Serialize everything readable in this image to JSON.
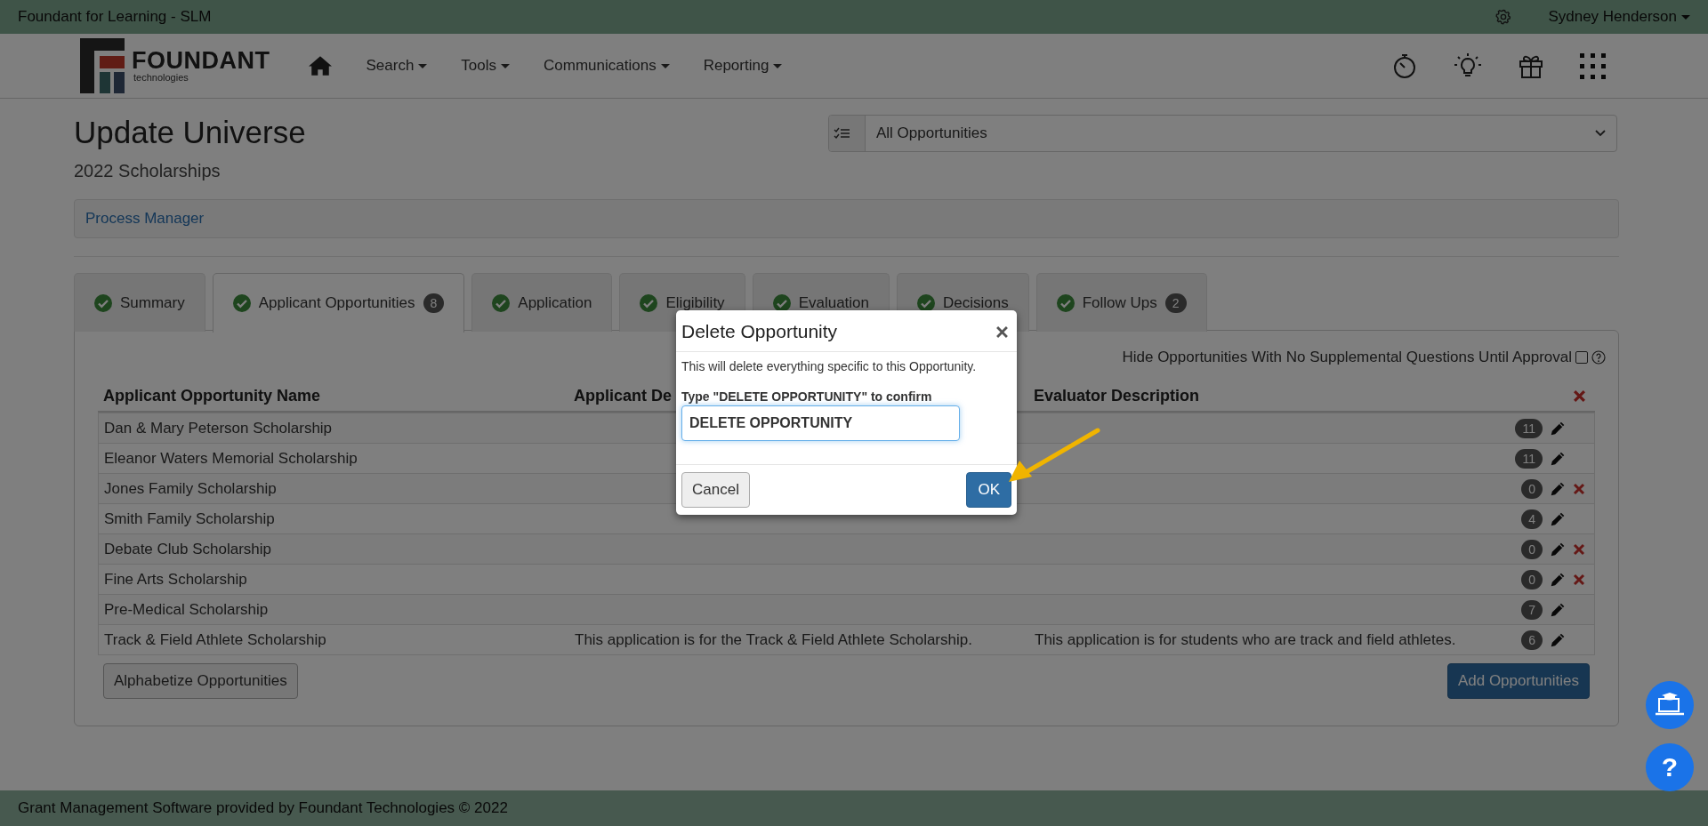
{
  "app_bar": {
    "title": "Foundant for Learning - SLM",
    "user": "Sydney Henderson"
  },
  "logo": {
    "name": "FOUNDANT",
    "tagline": "technologies"
  },
  "nav": [
    {
      "label": "Search"
    },
    {
      "label": "Tools"
    },
    {
      "label": "Communications"
    },
    {
      "label": "Reporting"
    }
  ],
  "page": {
    "title": "Update Universe",
    "subtitle": "2022 Scholarships",
    "filter": "All Opportunities",
    "breadcrumb": "Process Manager"
  },
  "tabs": [
    {
      "label": "Summary",
      "selected": false,
      "complete": true
    },
    {
      "label": "Applicant Opportunities",
      "selected": true,
      "complete": true,
      "badge": "8"
    },
    {
      "label": "Application",
      "selected": false,
      "complete": true
    },
    {
      "label": "Eligibility",
      "selected": false,
      "complete": true
    },
    {
      "label": "Evaluation",
      "selected": false,
      "complete": true
    },
    {
      "label": "Decisions",
      "selected": false,
      "complete": true
    },
    {
      "label": "Follow Ups",
      "selected": false,
      "complete": true,
      "badge": "2"
    }
  ],
  "hide_option": {
    "label": "Hide Opportunities With No Supplemental Questions Until Approval",
    "checked": false
  },
  "table": {
    "columns": [
      "Applicant Opportunity Name",
      "Applicant De",
      "Evaluator Description"
    ],
    "rows": [
      {
        "name": "Dan & Mary Peterson Scholarship",
        "count": "11",
        "deletable": false
      },
      {
        "name": "Eleanor Waters Memorial Scholarship",
        "count": "11",
        "deletable": false
      },
      {
        "name": "Jones Family Scholarship",
        "count": "0",
        "deletable": true
      },
      {
        "name": "Smith Family Scholarship",
        "count": "4",
        "deletable": false
      },
      {
        "name": "Debate Club Scholarship",
        "count": "0",
        "deletable": true
      },
      {
        "name": "Fine Arts Scholarship",
        "count": "0",
        "deletable": true
      },
      {
        "name": "Pre-Medical Scholarship",
        "count": "7",
        "deletable": false
      },
      {
        "name": "Track & Field Athlete Scholarship",
        "applicant_description": "This application is for the Track & Field Athlete Scholarship.",
        "evaluator_description": "This application is for students who are track and field athletes.",
        "count": "6",
        "deletable": false
      }
    ]
  },
  "buttons": {
    "alphabetize": "Alphabetize Opportunities",
    "add": "Add Opportunities"
  },
  "footer": "Grant Management Software provided by Foundant Technologies © 2022",
  "help_label": "?",
  "dialog": {
    "title": "Delete Opportunity",
    "message": "This will delete everything specific to this Opportunity.",
    "label": "Type \"DELETE OPPORTUNITY\" to confirm",
    "value": "DELETE OPPORTUNITY",
    "cancel": "Cancel",
    "ok": "OK"
  }
}
